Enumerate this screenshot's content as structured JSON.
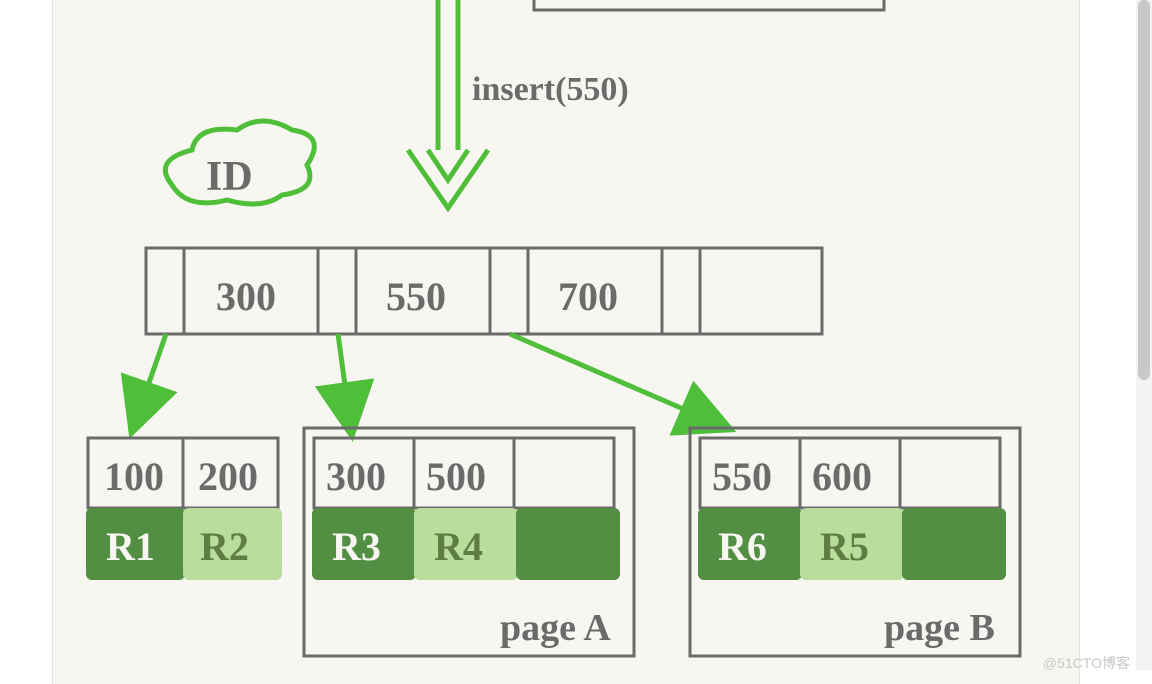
{
  "operation_label": "insert(550)",
  "id_label": "ID",
  "index_node": {
    "keys": [
      "300",
      "550",
      "700",
      ""
    ]
  },
  "leaf1": {
    "keys": [
      "100",
      "200"
    ],
    "rows": [
      "R1",
      "R2"
    ],
    "page": ""
  },
  "leaf2": {
    "keys": [
      "300",
      "500",
      ""
    ],
    "rows": [
      "R3",
      "R4",
      ""
    ],
    "page": "page A"
  },
  "leaf3": {
    "keys": [
      "550",
      "600",
      ""
    ],
    "rows": [
      "R6",
      "R5",
      ""
    ],
    "page": "page B"
  },
  "watermark": "@51CTO博客",
  "colors": {
    "outline": "#6b6b6b",
    "arrow": "#4fbf3a",
    "cloud": "#4fbf3a",
    "row_dark": "#528f43",
    "row_light": "#b9dd9c"
  }
}
